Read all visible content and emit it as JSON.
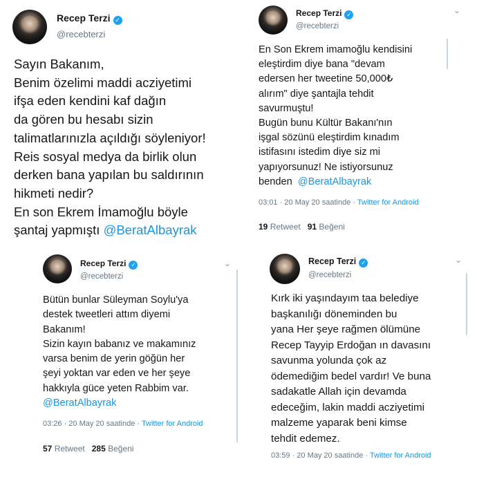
{
  "tweets": [
    {
      "name": "Recep Terzi",
      "handle": "@recebterzi",
      "verified": "✓",
      "chevron": "⌄",
      "body": "Sayın Bakanım,\nBenim özelimi maddi acziyetimi\nifşa eden kendini kaf dağın\nda gören bu hesabı sizin\ntalimatlarınızla açıldığı söyleniyor!\nReis sosyal medya da birlik olun\nderken bana yapılan bu saldırının\nhikmeti nedir?\nEn son Ekrem İmamoğlu böyle\nşantaj yapmıştı ",
      "mention": "@BeratAlbayrak"
    },
    {
      "name": "Recep Terzi",
      "handle": "@recebterzi",
      "verified": "✓",
      "chevron": "⌄",
      "body": "En Son Ekrem imamoğlu kendisini\neleştirdim diye bana \"devam\nedersen her tweetine 50,000₺\nalırım\" diye şantajla tehdit\nsavurmuştu!\nBugün bunu Kültür Bakanı'nın\nişgal sözünü eleştirdim kınadım\nistifasını istedim diye siz mi\nyapıyorsunuz! Ne istiyorsunuz\nbenden  ",
      "mention": "@BeratAlbayrak",
      "time": "03:01 · 20 May 20 saatinde · ",
      "source": "Twitter for Android",
      "retweets": "19",
      "retweets_label": " Retweet",
      "likes": "91",
      "likes_label": " Beğeni"
    },
    {
      "name": "Recep Terzi",
      "handle": "@recebterzi",
      "verified": "✓",
      "chevron": "⌄",
      "body": "Bütün bunlar Süleyman Soylu'ya\ndestek tweetleri attım diyemi\nBakanım!\nSizin kayın babanız ve makamınız\nvarsa benim de yerin göğün her\nşeyi yoktan var eden ve her şeye\nhakkıyla güce yeten Rabbim var.\n",
      "mention": "@BeratAlbayrak",
      "time": "03:26 · 20 May 20 saatinde · ",
      "source": "Twitter for Android",
      "retweets": "57",
      "retweets_label": " Retweet",
      "likes": "285",
      "likes_label": " Beğeni"
    },
    {
      "name": "Recep Terzi",
      "handle": "@recebterzi",
      "verified": "✓",
      "chevron": "⌄",
      "body": "Kırk iki yaşındayım taa belediye\nbaşkanılığı döneminden bu\nyana Her şeye rağmen ölümüne\nRecep Tayyip Erdoğan ın davasını\nsavunma yolunda çok az\nödemediğim bedel vardır! Ve buna\nsadakatle Allah için devamda\nedeceğim, lakin maddi acziyetimi\nmalzeme yaparak beni kimse\ntehdit edemez.",
      "time": "03:59 · 20 May 20 saatinde · ",
      "source": "Twitter for Android"
    }
  ]
}
